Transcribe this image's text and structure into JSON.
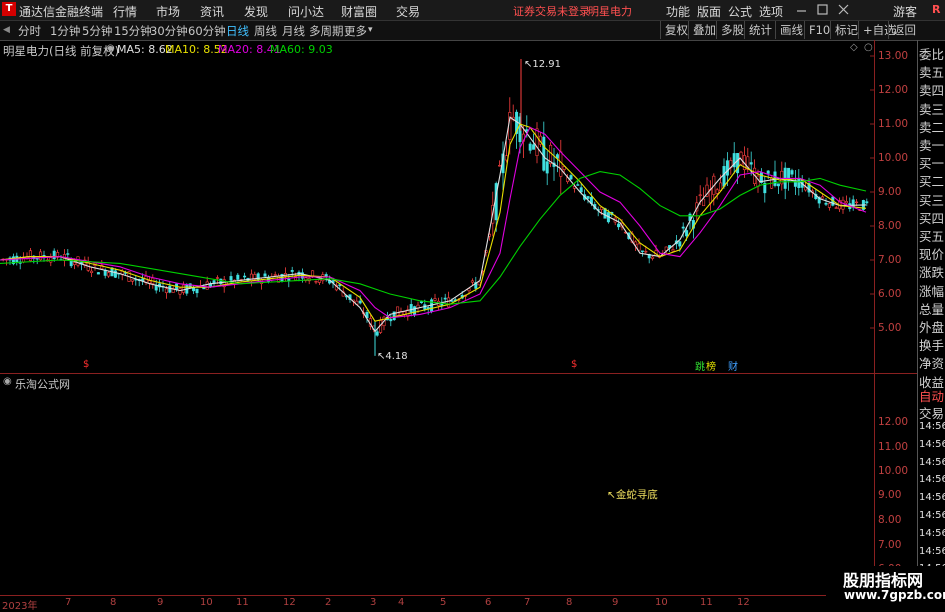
{
  "titlebar": {
    "app_name": "通达信金融终端",
    "menu": [
      "行情",
      "市场",
      "资讯",
      "发现",
      "问小达",
      "财富圈",
      "交易"
    ],
    "notice": "证券交易未登录",
    "stock": "明星电力",
    "right_menu": [
      "功能",
      "版面",
      "公式",
      "选项"
    ],
    "guest": "游客",
    "r_label": "R"
  },
  "toolbar": {
    "periods": [
      "分时",
      "1分钟",
      "5分钟",
      "15分钟",
      "30分钟",
      "60分钟",
      "日线",
      "周线",
      "月线",
      "多周期",
      "更多"
    ],
    "active_period": "日线",
    "right_buttons": [
      "复权",
      "叠加",
      "多股",
      "统计",
      "画线",
      "F10",
      "标记",
      "+自选",
      "返回"
    ]
  },
  "chart_header": {
    "title": "明星电力(日线 前复权)",
    "ma5": "MA5: 8.62",
    "ma10": "MA10: 8.52",
    "ma20": "MA20: 8.41",
    "ma60": "MA60: 9.03"
  },
  "colors": {
    "ma5": "#e0e0e0",
    "ma10": "#e8e000",
    "ma20": "#e000e0",
    "ma60": "#00d000",
    "up": "#ff4040",
    "down": "#40e0e0",
    "axis": "#c04040"
  },
  "chart_data": {
    "type": "line",
    "y_ticks": [
      "13.00",
      "12.00",
      "11.00",
      "10.00",
      "9.00",
      "8.00",
      "7.00",
      "6.00",
      "5.00"
    ],
    "ylim": [
      4.0,
      13.5
    ],
    "high_label": "12.91",
    "low_label": "4.18",
    "series": [
      {
        "name": "MA5",
        "x": [
          0,
          30,
          60,
          90,
          120,
          150,
          180,
          210,
          240,
          270,
          300,
          330,
          360,
          375,
          390,
          420,
          450,
          480,
          500,
          510,
          520,
          530,
          545,
          560,
          580,
          600,
          620,
          640,
          660,
          680,
          700,
          720,
          740,
          760,
          780,
          800,
          820,
          840,
          866
        ],
        "values": [
          7.0,
          7.1,
          7.1,
          6.8,
          6.6,
          6.3,
          6.1,
          6.3,
          6.4,
          6.5,
          6.6,
          6.4,
          5.6,
          4.9,
          5.4,
          5.6,
          5.8,
          6.4,
          9.5,
          11.2,
          11.0,
          10.6,
          10.0,
          9.7,
          9.0,
          8.4,
          8.1,
          7.2,
          7.1,
          7.6,
          8.7,
          9.4,
          10.0,
          9.3,
          9.4,
          9.3,
          8.8,
          8.6,
          8.62
        ]
      },
      {
        "name": "MA10",
        "x": [
          0,
          30,
          60,
          90,
          120,
          150,
          180,
          210,
          240,
          270,
          300,
          330,
          360,
          375,
          390,
          420,
          450,
          480,
          500,
          510,
          520,
          530,
          545,
          560,
          580,
          600,
          620,
          640,
          660,
          680,
          700,
          720,
          740,
          760,
          780,
          800,
          820,
          840,
          866
        ],
        "values": [
          7.0,
          7.1,
          7.1,
          6.9,
          6.7,
          6.4,
          6.2,
          6.2,
          6.35,
          6.45,
          6.55,
          6.5,
          5.9,
          5.2,
          5.3,
          5.5,
          5.7,
          6.2,
          8.4,
          10.4,
          11.0,
          10.9,
          10.3,
          9.9,
          9.3,
          8.6,
          8.2,
          7.5,
          7.1,
          7.3,
          8.3,
          9.0,
          9.8,
          9.5,
          9.35,
          9.4,
          9.0,
          8.6,
          8.52
        ]
      },
      {
        "name": "MA20",
        "x": [
          0,
          30,
          60,
          90,
          120,
          150,
          180,
          210,
          240,
          270,
          300,
          330,
          360,
          375,
          390,
          420,
          450,
          480,
          500,
          510,
          520,
          530,
          545,
          560,
          580,
          600,
          620,
          640,
          660,
          680,
          700,
          720,
          740,
          760,
          780,
          800,
          820,
          840,
          866
        ],
        "values": [
          7.0,
          7.05,
          7.1,
          6.95,
          6.8,
          6.5,
          6.3,
          6.2,
          6.3,
          6.4,
          6.5,
          6.5,
          6.1,
          5.6,
          5.3,
          5.4,
          5.6,
          6.0,
          7.2,
          8.8,
          10.3,
          10.9,
          10.7,
          10.2,
          9.6,
          9.0,
          8.7,
          8.0,
          7.2,
          7.1,
          7.8,
          8.6,
          9.5,
          9.6,
          9.4,
          9.4,
          9.2,
          8.7,
          8.41
        ]
      },
      {
        "name": "MA60",
        "x": [
          0,
          60,
          120,
          180,
          240,
          300,
          330,
          360,
          390,
          420,
          450,
          480,
          500,
          520,
          540,
          560,
          580,
          600,
          620,
          640,
          660,
          680,
          700,
          720,
          740,
          760,
          780,
          800,
          820,
          840,
          866
        ],
        "values": [
          6.9,
          7.0,
          6.9,
          6.6,
          6.3,
          6.4,
          6.45,
          6.3,
          6.0,
          5.8,
          5.7,
          5.8,
          6.5,
          7.4,
          8.2,
          8.9,
          9.4,
          9.6,
          9.5,
          9.1,
          8.6,
          8.3,
          8.3,
          8.5,
          8.9,
          9.2,
          9.3,
          9.3,
          9.4,
          9.2,
          9.03
        ]
      }
    ]
  },
  "markers": {
    "dollar": "$",
    "jump_badge": "跳",
    "rank_badge": "榜",
    "fin_badge": "财"
  },
  "lower_panel": {
    "title": "乐淘公式网",
    "y_ticks": [
      "12.00",
      "11.00",
      "10.00",
      "9.00",
      "8.00",
      "7.00",
      "6.00"
    ],
    "signal": "金蛇寻底"
  },
  "x_axis": {
    "labels": [
      "2023年",
      "7",
      "8",
      "9",
      "10",
      "11",
      "12",
      "2",
      "3",
      "4",
      "5",
      "6",
      "7",
      "8",
      "9",
      "10",
      "11",
      "12"
    ]
  },
  "right_panel": {
    "items": [
      "委比",
      "卖五",
      "卖四",
      "卖三",
      "卖二",
      "卖一",
      "买一",
      "买二",
      "买三",
      "买四",
      "买五",
      "现价",
      "涨跌",
      "涨幅",
      "总量",
      "外盘",
      "换手",
      "净资",
      "收益"
    ],
    "auto": "自动",
    "trade": "交易",
    "times": [
      "14:56",
      "14:56",
      "14:56",
      "14:56",
      "14:56",
      "14:56",
      "14:56",
      "14:56",
      "14:56",
      "14:56"
    ]
  },
  "watermark": {
    "name": "股朋指标网",
    "url": "www.7gpzb.com"
  }
}
